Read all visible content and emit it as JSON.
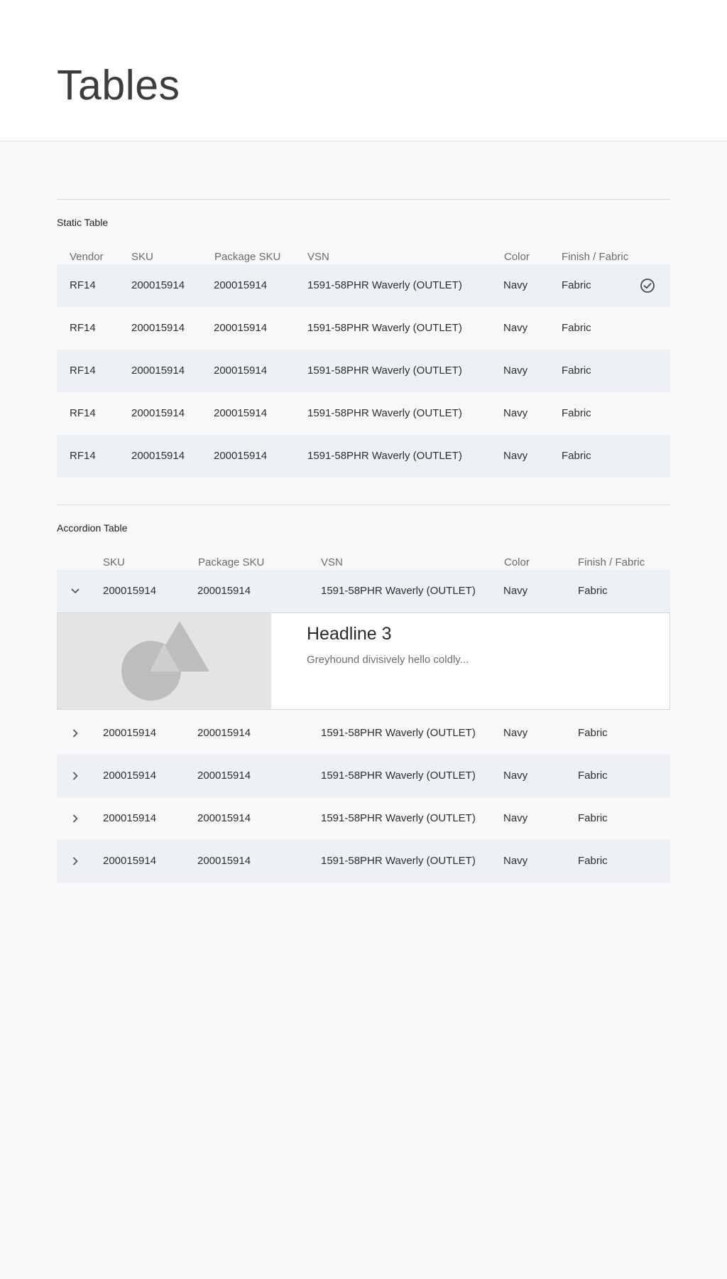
{
  "page": {
    "title": "Tables"
  },
  "static_table": {
    "title": "Static Table",
    "headers": [
      "Vendor",
      "SKU",
      "Package SKU",
      "VSN",
      "Color",
      "Finish / Fabric"
    ],
    "rows": [
      {
        "vendor": "RF14",
        "sku": "200015914",
        "package_sku": "200015914",
        "vsn": "1591-58PHR Waverly (OUTLET)",
        "color": "Navy",
        "finish": "Fabric",
        "selected": true
      },
      {
        "vendor": "RF14",
        "sku": "200015914",
        "package_sku": "200015914",
        "vsn": "1591-58PHR Waverly (OUTLET)",
        "color": "Navy",
        "finish": "Fabric",
        "selected": false
      },
      {
        "vendor": "RF14",
        "sku": "200015914",
        "package_sku": "200015914",
        "vsn": "1591-58PHR Waverly (OUTLET)",
        "color": "Navy",
        "finish": "Fabric",
        "selected": false
      },
      {
        "vendor": "RF14",
        "sku": "200015914",
        "package_sku": "200015914",
        "vsn": "1591-58PHR Waverly (OUTLET)",
        "color": "Navy",
        "finish": "Fabric",
        "selected": false
      },
      {
        "vendor": "RF14",
        "sku": "200015914",
        "package_sku": "200015914",
        "vsn": "1591-58PHR Waverly (OUTLET)",
        "color": "Navy",
        "finish": "Fabric",
        "selected": false
      }
    ]
  },
  "accordion_table": {
    "title": "Accordion Table",
    "headers": [
      "SKU",
      "Package SKU",
      "VSN",
      "Color",
      "Finish / Fabric"
    ],
    "rows": [
      {
        "sku": "200015914",
        "package_sku": "200015914",
        "vsn": "1591-58PHR Waverly (OUTLET)",
        "color": "Navy",
        "finish": "Fabric",
        "expanded": true
      },
      {
        "sku": "200015914",
        "package_sku": "200015914",
        "vsn": "1591-58PHR Waverly (OUTLET)",
        "color": "Navy",
        "finish": "Fabric",
        "expanded": false
      },
      {
        "sku": "200015914",
        "package_sku": "200015914",
        "vsn": "1591-58PHR Waverly (OUTLET)",
        "color": "Navy",
        "finish": "Fabric",
        "expanded": false
      },
      {
        "sku": "200015914",
        "package_sku": "200015914",
        "vsn": "1591-58PHR Waverly (OUTLET)",
        "color": "Navy",
        "finish": "Fabric",
        "expanded": false
      },
      {
        "sku": "200015914",
        "package_sku": "200015914",
        "vsn": "1591-58PHR Waverly (OUTLET)",
        "color": "Navy",
        "finish": "Fabric",
        "expanded": false
      }
    ],
    "expanded_panel": {
      "headline": "Headline 3",
      "body": "Greyhound divisively hello coldly..."
    }
  },
  "icons": {
    "selected": "check-circle-icon",
    "expanded": "chevron-down-icon",
    "collapsed": "chevron-right-icon",
    "placeholder": "image-placeholder-icon"
  },
  "colors": {
    "row_shade": "#edf0f5",
    "page_bg": "#f8f8f9",
    "header_bg": "#ffffff"
  }
}
